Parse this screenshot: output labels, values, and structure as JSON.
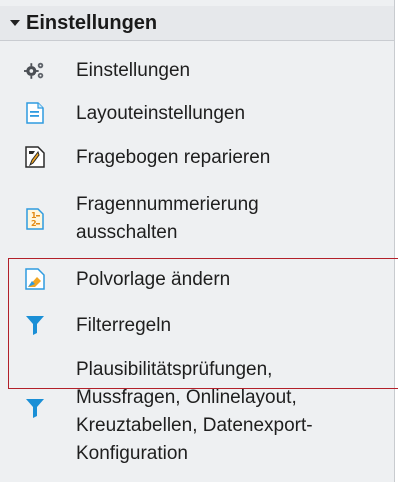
{
  "panel": {
    "header": "Einstellungen",
    "items": [
      {
        "label": "Einstellungen",
        "icon": "gears-icon"
      },
      {
        "label": "Layouteinstellungen",
        "icon": "document-icon"
      },
      {
        "label": "Fragebogen reparieren",
        "icon": "wrench-icon"
      },
      {
        "label_lines": [
          "Fragennummerierung",
          "ausschalten"
        ],
        "icon": "numbering-icon"
      },
      {
        "label": "Polvorlage ändern",
        "icon": "template-icon"
      },
      {
        "label": "Filterregeln",
        "icon": "filter-icon"
      },
      {
        "label_lines": [
          "Plausibilitätsprüfungen,",
          "Mussfragen, Onlinelayout,",
          "Kreuztabellen, Datenexport-",
          "Konfiguration"
        ],
        "icon": "filter-icon"
      }
    ]
  },
  "colors": {
    "panel_bg": "#eef0f2",
    "highlight": "#b2202a",
    "filter_blue": "#1a8fd6"
  }
}
